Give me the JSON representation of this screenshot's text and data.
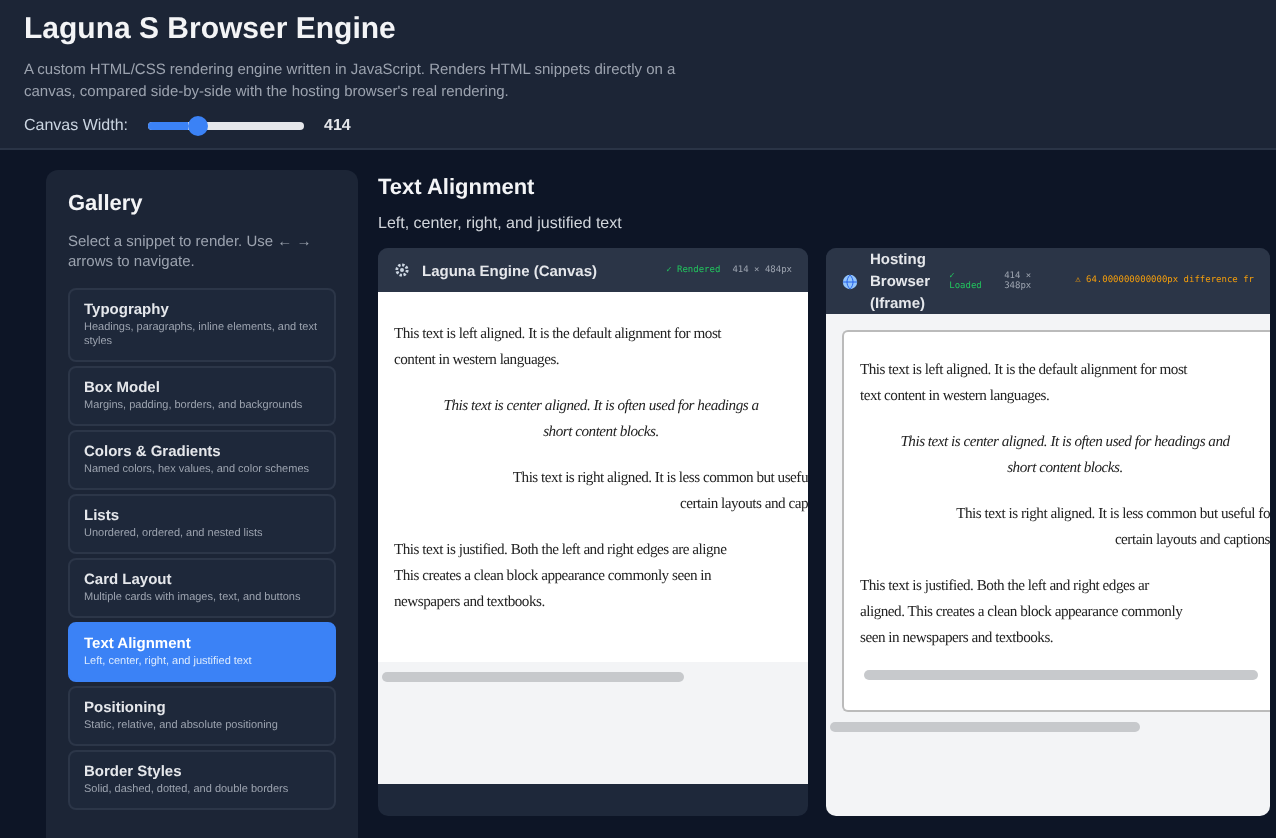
{
  "header": {
    "title": "Laguna S Browser Engine",
    "description": "A custom HTML/CSS rendering engine written in JavaScript. Renders HTML snippets directly on a canvas, compared side-by-side with the hosting browser's real rendering.",
    "slider": {
      "label": "Canvas Width:",
      "level": 0.25,
      "value": "414"
    }
  },
  "gallery": {
    "title": "Gallery",
    "hint": "Select a snippet to render. Use ← → arrows to navigate.",
    "items": [
      {
        "title": "Typography",
        "description": "Headings, paragraphs, inline elements, and text styles",
        "selected": false
      },
      {
        "title": "Box Model",
        "description": "Margins, padding, borders, and backgrounds",
        "selected": false
      },
      {
        "title": "Colors & Gradients",
        "description": "Named colors, hex values, and color schemes",
        "selected": false
      },
      {
        "title": "Lists",
        "description": "Unordered, ordered, and nested lists",
        "selected": false
      },
      {
        "title": "Card Layout",
        "description": "Multiple cards with images, text, and buttons",
        "selected": false
      },
      {
        "title": "Text Alignment",
        "description": "Left, center, right, and justified text",
        "selected": true
      },
      {
        "title": "Positioning",
        "description": "Static, relative, and absolute positioning",
        "selected": false
      },
      {
        "title": "Border Styles",
        "description": "Solid, dashed, dotted, and double borders",
        "selected": false
      }
    ]
  },
  "main": {
    "title": "Text Alignment",
    "subtitle": "Left, center, right, and justified text",
    "panes": [
      {
        "kind": "canvas",
        "title": "Laguna Engine (Canvas)",
        "status": "✓ Rendered",
        "size": "414 × 484px",
        "paragraphs": [
          {
            "kind": "left",
            "lines": [
              "This text is left aligned. It is the default alignment for most",
              "content in western languages."
            ]
          },
          {
            "kind": "center",
            "lines": [
              "This text is center aligned. It is often used for headings a",
              "short content blocks."
            ]
          },
          {
            "kind": "right",
            "lines": [
              "This text is right aligned. It is less common but usefu",
              "certain layouts and cap"
            ]
          },
          {
            "kind": "justify",
            "lines": [
              "This text is justified. Both the left and right edges are aligne",
              "This creates a clean block appearance commonly seen in",
              "newspapers and textbooks."
            ]
          }
        ]
      },
      {
        "kind": "iframe",
        "title": "Hosting Browser (Iframe)",
        "status": "✓ Loaded",
        "size": "414 × 348px",
        "warning": "⚠ 64.000000000000px difference fr",
        "paragraphs": [
          {
            "kind": "left",
            "lines": [
              "This text is left aligned. It is the default alignment for most",
              "text content in western languages."
            ]
          },
          {
            "kind": "center",
            "lines": [
              "This text is center aligned. It is often used for headings and",
              "short content blocks."
            ]
          },
          {
            "kind": "right",
            "lines": [
              "This text is right aligned. It is less common but useful fo",
              "certain layouts and captions"
            ]
          },
          {
            "kind": "justify",
            "lines": [
              "This text is justified. Both the left and right edges ar",
              "aligned. This creates a clean block appearance commonly",
              "seen in newspapers and textbooks."
            ]
          }
        ]
      }
    ]
  }
}
